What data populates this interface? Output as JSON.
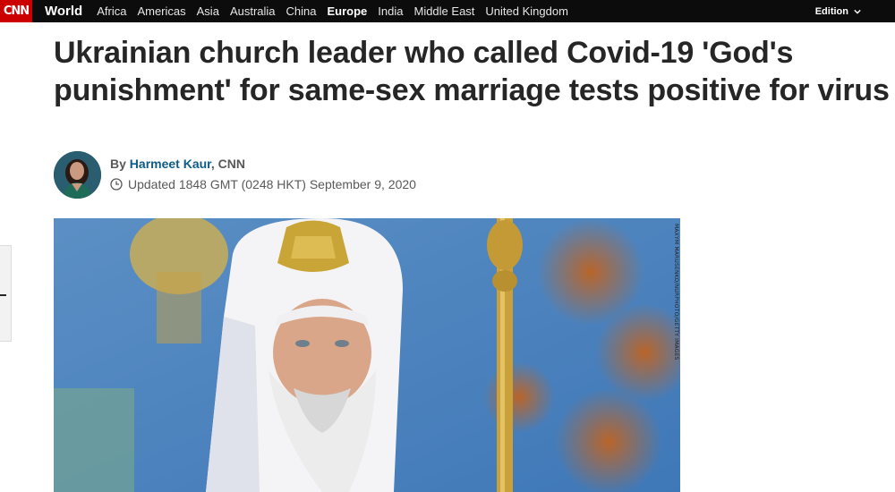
{
  "nav": {
    "logo_text": "CNN",
    "section": "World",
    "links": [
      "Africa",
      "Americas",
      "Asia",
      "Australia",
      "China",
      "Europe",
      "India",
      "Middle East",
      "United Kingdom"
    ],
    "active_link": "Europe",
    "edition_label": "Edition",
    "edition_icon": "chevron-down-icon"
  },
  "article": {
    "headline": "Ukrainian church leader who called Covid-19 'God's punishment' for same-sex marriage tests positive for virus",
    "byline_prefix": "By ",
    "author": "Harmeet Kaur",
    "outlet": ", CNN",
    "clock_icon": "clock-icon",
    "updated": "Updated 1848 GMT (0248 HKT) September 9, 2020"
  },
  "hero": {
    "credit": "MAXYM MARUSENKO/NURPHOTO/GETTY IMAGES"
  },
  "colors": {
    "nav_bg": "#0c0c0c",
    "brand_red": "#cc0000",
    "author_link": "#0c5c8a",
    "headline": "#262626",
    "meta_text": "#595959"
  }
}
